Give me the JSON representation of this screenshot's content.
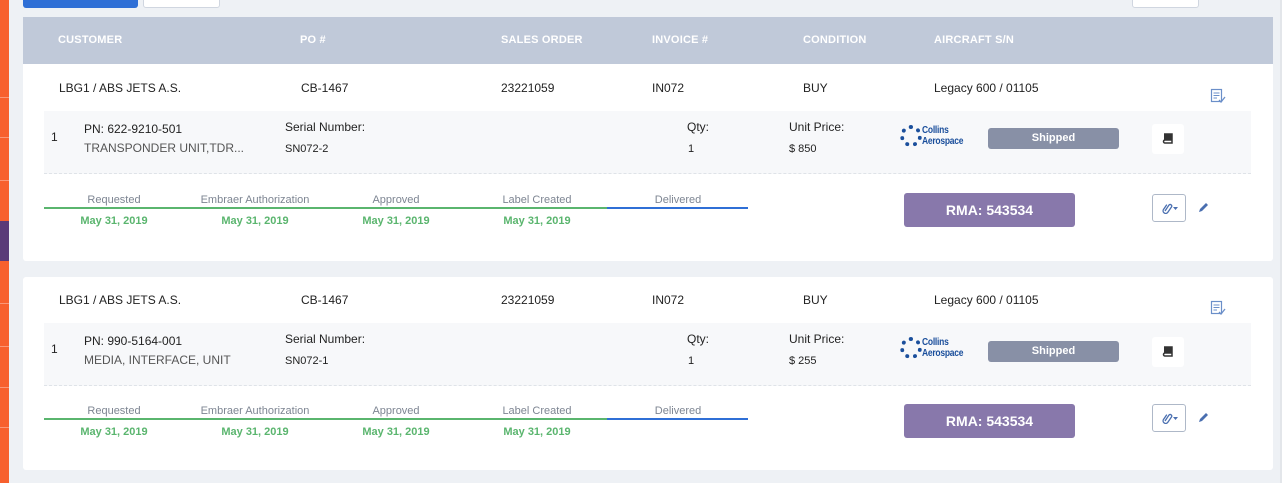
{
  "header": {
    "customer": "CUSTOMER",
    "po": "PO #",
    "sales_order": "SALES ORDER",
    "invoice": "INVOICE #",
    "condition": "CONDITION",
    "aircraft": "AIRCRAFT S/N"
  },
  "orders": [
    {
      "customer": "LBG1 / ABS JETS A.S.",
      "po": "CB-1467",
      "sales_order": "23221059",
      "invoice": "IN072",
      "condition": "BUY",
      "aircraft": "Legacy 600 / 01105",
      "item": {
        "index": "1",
        "pn": "PN: 622-9210-501",
        "description": "TRANSPONDER UNIT,TDR...",
        "serial_label": "Serial Number:",
        "serial": "SN072-2",
        "qty_label": "Qty:",
        "qty": "1",
        "price_label": "Unit Price:",
        "price": "$ 850",
        "vendor_line1": "Collins",
        "vendor_line2": "Aerospace",
        "status": "Shipped"
      },
      "timeline": [
        {
          "label": "Requested",
          "date": "May 31, 2019"
        },
        {
          "label": "Embraer Authorization",
          "date": "May 31, 2019"
        },
        {
          "label": "Approved",
          "date": "May 31, 2019"
        },
        {
          "label": "Label Created",
          "date": "May 31, 2019"
        },
        {
          "label": "Delivered",
          "date": ""
        }
      ],
      "rma": "RMA: 543534"
    },
    {
      "customer": "LBG1 / ABS JETS A.S.",
      "po": "CB-1467",
      "sales_order": "23221059",
      "invoice": "IN072",
      "condition": "BUY",
      "aircraft": "Legacy 600 / 01105",
      "item": {
        "index": "1",
        "pn": "PN: 990-5164-001",
        "description": "MEDIA, INTERFACE, UNIT",
        "serial_label": "Serial Number:",
        "serial": "SN072-1",
        "qty_label": "Qty:",
        "qty": "1",
        "price_label": "Unit Price:",
        "price": "$ 255",
        "vendor_line1": "Collins",
        "vendor_line2": "Aerospace",
        "status": "Shipped"
      },
      "timeline": [
        {
          "label": "Requested",
          "date": "May 31, 2019"
        },
        {
          "label": "Embraer Authorization",
          "date": "May 31, 2019"
        },
        {
          "label": "Approved",
          "date": "May 31, 2019"
        },
        {
          "label": "Label Created",
          "date": "May 31, 2019"
        },
        {
          "label": "Delivered",
          "date": ""
        }
      ],
      "rma": "RMA: 543534"
    }
  ],
  "colors": {
    "accent_strip": "#f7602e",
    "header_bg": "#c0c9d9",
    "progress_done": "#5ab56e",
    "progress_current": "#2f6fd6",
    "rma_bg": "#8878ab",
    "status_bg": "#8890a6",
    "brand_blue": "#1b4f9c"
  },
  "icons": [
    "checklist-icon",
    "book-icon",
    "paperclip-icon",
    "chevron-down-icon",
    "pencil-icon",
    "collins-aerospace-logo"
  ]
}
